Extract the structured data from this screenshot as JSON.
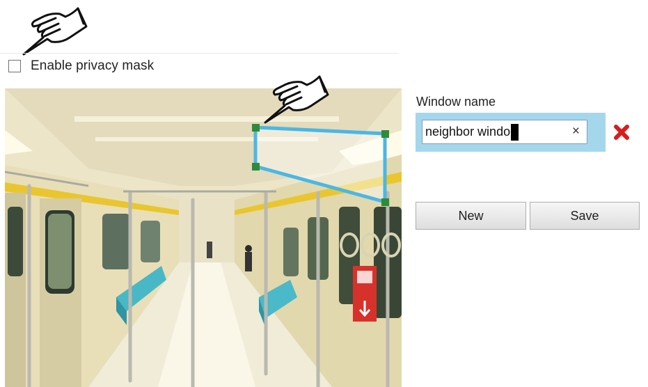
{
  "privacy": {
    "enable_label": "Enable privacy mask",
    "enabled": false
  },
  "editor": {
    "window_name_label": "Window name",
    "window_name_value": "neighbor windo",
    "clear_glyph": "×",
    "new_label": "New",
    "save_label": "Save"
  },
  "icons": {
    "pointer": "hand-pointer-icon",
    "delete": "red-x-delete-icon",
    "clear": "close-icon"
  },
  "colors": {
    "mask_outline": "#4ab7e6",
    "mask_handle": "#2f8a3a",
    "name_panel": "#a5d7ec",
    "delete": "#d61e1e"
  }
}
